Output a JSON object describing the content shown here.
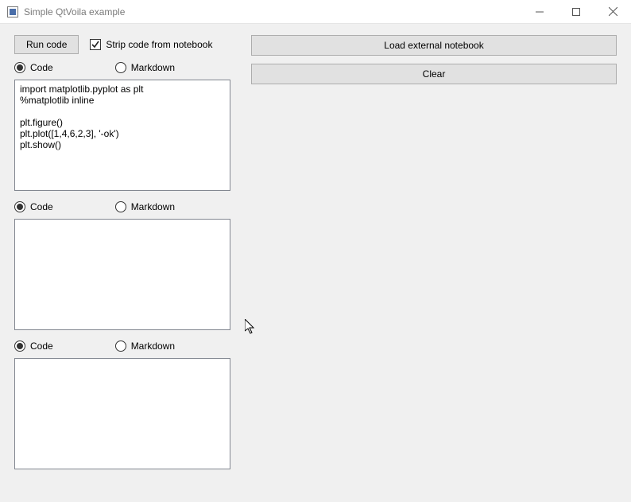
{
  "window": {
    "title": "Simple QtVoila example"
  },
  "toolbar": {
    "run_label": "Run code",
    "strip_label": "Strip code from notebook"
  },
  "right": {
    "load_label": "Load external notebook",
    "clear_label": "Clear"
  },
  "radios": {
    "code_label": "Code",
    "markdown_label": "Markdown"
  },
  "cells": [
    {
      "content": "import matplotlib.pyplot as plt\n%matplotlib inline\n\nplt.figure()\nplt.plot([1,4,6,2,3], '-ok')\nplt.show()"
    },
    {
      "content": ""
    },
    {
      "content": ""
    }
  ]
}
